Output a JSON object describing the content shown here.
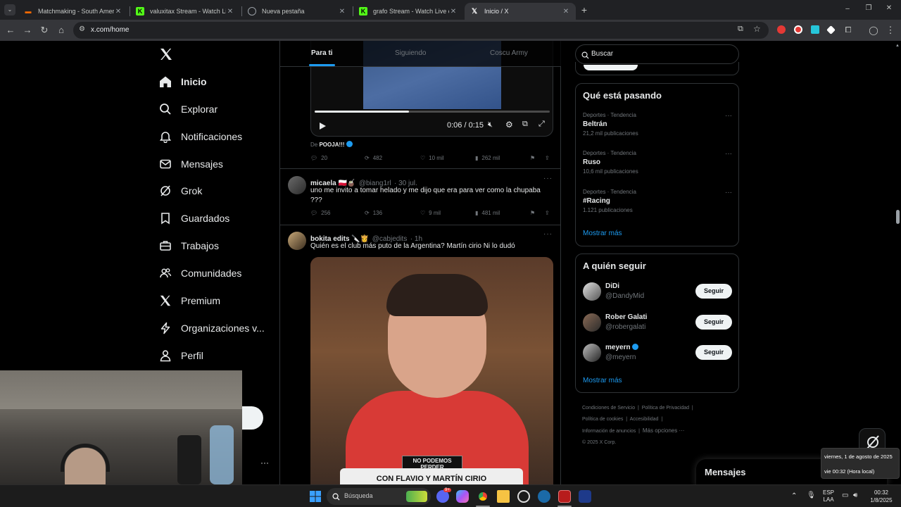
{
  "browser": {
    "tabs": [
      {
        "title": "Matchmaking - South America",
        "active": false,
        "favicon_color": "#ff6a00"
      },
      {
        "title": "valuxitax Stream - Watch Live o",
        "active": false,
        "favicon_color": "#53fc18"
      },
      {
        "title": "Nueva pestaña",
        "active": false,
        "favicon_color": "#9aa0a6"
      },
      {
        "title": "grafo Stream - Watch Live on Ki",
        "active": false,
        "favicon_color": "#53fc18"
      },
      {
        "title": "Inicio / X",
        "active": true,
        "favicon_color": "#ffffff"
      }
    ],
    "new_tab_glyph": "+",
    "url": "x.com/home",
    "window_controls": [
      "–",
      "❐",
      "✕"
    ]
  },
  "sidebar": {
    "logo": "X",
    "items": [
      {
        "label": "Inicio",
        "icon": "home-icon",
        "active": true
      },
      {
        "label": "Explorar",
        "icon": "search-icon"
      },
      {
        "label": "Notificaciones",
        "icon": "bell-icon"
      },
      {
        "label": "Mensajes",
        "icon": "mail-icon"
      },
      {
        "label": "Grok",
        "icon": "grok-icon"
      },
      {
        "label": "Guardados",
        "icon": "bookmark-icon"
      },
      {
        "label": "Trabajos",
        "icon": "briefcase-icon"
      },
      {
        "label": "Comunidades",
        "icon": "people-icon"
      },
      {
        "label": "Premium",
        "icon": "x-logo-icon"
      },
      {
        "label": "Organizaciones v...",
        "icon": "lightning-icon"
      },
      {
        "label": "Perfil",
        "icon": "person-icon"
      }
    ],
    "more_glyph": "···"
  },
  "feed": {
    "tabs": [
      "Para ti",
      "Siguiendo",
      "Coscu Army"
    ],
    "active_tab": "Para ti",
    "video_post": {
      "current_time": "0:06",
      "duration": "0:15",
      "progress": 0.4,
      "from_prefix": "De",
      "from_name": "POOJA!!!",
      "replies": "20",
      "reposts": "482",
      "likes": "10 mil",
      "views": "262 mil"
    },
    "posts": [
      {
        "name": "micaela 🇵🇱🧉",
        "handle": "@biang1rl",
        "time": "· 30 jul.",
        "text": "uno me invito a tomar helado y me dijo que era para ver como la chupaba ???",
        "replies": "256",
        "reposts": "136",
        "likes": "9 mil",
        "views": "481 mil"
      },
      {
        "name": "bokita edits 🔪👸",
        "handle": "@cabjedits",
        "time": "· 1h",
        "text": "Quién es el club más puto de la Argentina? Martín cirio Ni lo dudó",
        "overlay_badge": "NO PODEMOS PERDER",
        "overlay_caption": "CON FLAVIO Y MARTÍN CIRIO"
      }
    ]
  },
  "right": {
    "search_placeholder": "Buscar",
    "trends_title": "Qué está pasando",
    "trends": [
      {
        "context": "Deportes · Tendencia",
        "title": "Beltrán",
        "count": "21,2 mil publicaciones"
      },
      {
        "context": "Deportes · Tendencia",
        "title": "Ruso",
        "count": "10,6 mil publicaciones"
      },
      {
        "context": "Deportes · Tendencia",
        "title": "#Racing",
        "count": "1.121 publicaciones"
      }
    ],
    "show_more": "Mostrar más",
    "follow_title": "A quién seguir",
    "follow": [
      {
        "name": "DiDi",
        "handle": "@DandyMid",
        "verified": false
      },
      {
        "name": "Rober Galati",
        "handle": "@robergalati",
        "verified": false
      },
      {
        "name": "meyern",
        "handle": "@meyern",
        "verified": true
      }
    ],
    "follow_button": "Seguir",
    "footer": [
      "Condiciones de Servicio",
      "Política de Privacidad",
      "Política de cookies",
      "Accesibilidad",
      "Información de anuncios",
      "Más opciones ···",
      "© 2025 X Corp."
    ],
    "messages_title": "Mensajes"
  },
  "taskbar": {
    "search_placeholder": "Búsqueda",
    "lang_top": "ESP",
    "lang_bottom": "LAA",
    "time": "00:32",
    "date": "1/8/2025",
    "tooltip_date": "viernes, 1 de agosto de 2025",
    "tooltip_time": "vie 00:32 (Hora local)",
    "badge": "9+"
  },
  "colors": {
    "accent": "#1d9bf0",
    "background": "#000000",
    "border": "#2f3336"
  }
}
